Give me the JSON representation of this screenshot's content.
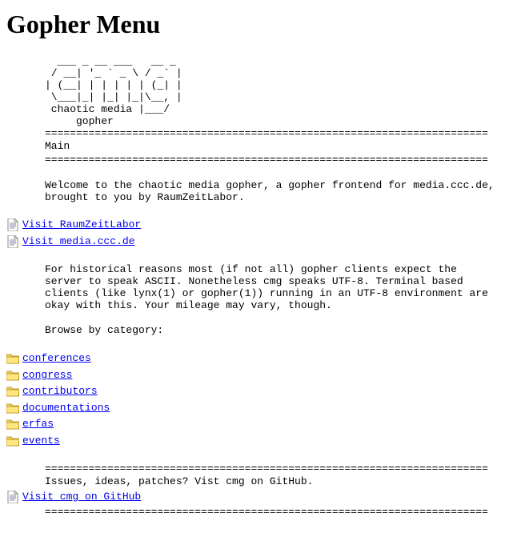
{
  "title": "Gopher Menu",
  "ascii_art": [
    "  ___ _ __ ___   __ _ ",
    " / __| '_ ` _ \\ / _` |",
    "| (__| | | | | | (_| |",
    " \\___|_| |_| |_|\\__, |",
    " chaotic media |___/",
    "     gopher"
  ],
  "hr": "=======================================================================",
  "main_label": "Main",
  "welcome": "Welcome to the chaotic media gopher, a gopher frontend for media.ccc.de,\nbrought to you by RaumZeitLabor.",
  "link_rzl": "Visit RaumZeitLabor",
  "link_mediaccc": "Visit media.ccc.de",
  "historical": "For historical reasons most (if not all) gopher clients expect the\nserver to speak ASCII. Nonetheless cmg speaks UTF-8. Terminal based\nclients (like lynx(1) or gopher(1)) running in an UTF-8 environment are\nokay with this. Your mileage may vary, though.",
  "browse_label": "Browse by category:",
  "categories": {
    "conferences": "conferences",
    "congress": "congress",
    "contributors": "contributors",
    "documentations": "documentations",
    "erfas": "erfas",
    "events": "events"
  },
  "issues_line": "Issues, ideas, patches? Vist cmg on GitHub.",
  "link_github": "Visit cmg on GitHub"
}
